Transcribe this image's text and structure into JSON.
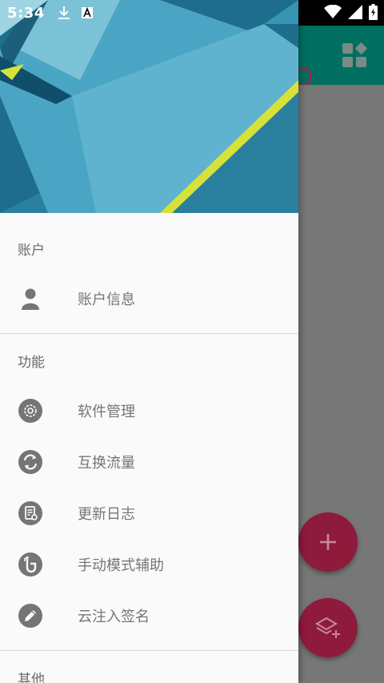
{
  "status_bar": {
    "time": "5:34",
    "icons": [
      "download-icon",
      "font-a-icon",
      "wifi-icon",
      "signal-icon",
      "battery-icon"
    ]
  },
  "drawer": {
    "sections": [
      {
        "title": "账户",
        "items": [
          {
            "label": "账户信息",
            "icon": "person-icon"
          }
        ]
      },
      {
        "title": "功能",
        "items": [
          {
            "label": "软件管理",
            "icon": "gear-icon"
          },
          {
            "label": "互换流量",
            "icon": "swap-icon"
          },
          {
            "label": "更新日志",
            "icon": "log-icon"
          },
          {
            "label": "手动模式辅助",
            "icon": "hand-icon"
          },
          {
            "label": "云注入签名",
            "icon": "pencil-icon"
          }
        ]
      },
      {
        "title": "其他",
        "items": []
      }
    ]
  },
  "app": {
    "fabs": [
      {
        "icon": "plus-icon"
      },
      {
        "icon": "layers-add-icon"
      }
    ],
    "toolbar_icon": "dashboard-grid-icon"
  },
  "colors": {
    "toolbar": "#006f5f",
    "fab": "#8e1a3c",
    "drawer_bg": "#fafafa",
    "icon_gray": "#757575"
  }
}
